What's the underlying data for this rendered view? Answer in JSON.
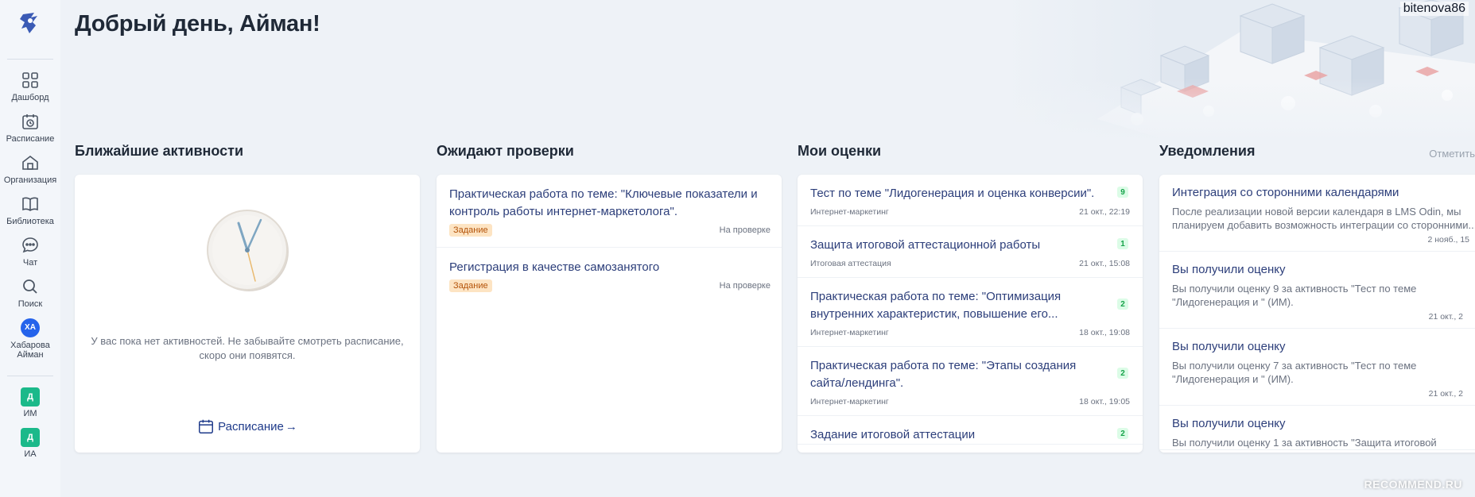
{
  "header": {
    "greeting": "Добрый день, Айман!",
    "username": "bitenova86"
  },
  "sidebar": {
    "items": [
      {
        "label": "Дашборд",
        "icon": "grid-icon"
      },
      {
        "label": "Расписание",
        "icon": "calendar-clock-icon"
      },
      {
        "label": "Организация",
        "icon": "home-icon"
      },
      {
        "label": "Библиотека",
        "icon": "book-icon"
      },
      {
        "label": "Чат",
        "icon": "chat-icon"
      },
      {
        "label": "Поиск",
        "icon": "search-icon"
      }
    ],
    "user": {
      "initials": "ХА",
      "name_line1": "Хабарова",
      "name_line2": "Айман"
    },
    "courses": [
      {
        "letter": "Д",
        "label": "ИМ"
      },
      {
        "letter": "Д",
        "label": "ИА"
      }
    ]
  },
  "activities": {
    "title": "Ближайшие активности",
    "empty_text": "У вас пока нет активностей. Не забывайте смотреть расписание, скоро они появятся.",
    "schedule_link": "Расписание"
  },
  "reviews": {
    "title": "Ожидают проверки",
    "items": [
      {
        "title": "Практическая работа по теме: \"Ключевые показатели и контроль работы интернет-маркетолога\".",
        "tag": "Задание",
        "status": "На проверке"
      },
      {
        "title": "Регистрация в качестве самозанятого",
        "tag": "Задание",
        "status": "На проверке"
      }
    ]
  },
  "grades": {
    "title": "Мои оценки",
    "items": [
      {
        "title": "Тест по теме \"Лидогенерация и оценка конверсии\".",
        "score": "9",
        "course": "Интернет-маркетинг",
        "date": "21 окт., 22:19"
      },
      {
        "title": "Защита итоговой аттестационной работы",
        "score": "1",
        "course": "Итоговая аттестация",
        "date": "21 окт., 15:08"
      },
      {
        "title": "Практическая работа по теме: \"Оптимизация внутренних характеристик, повышение его...",
        "score": "2",
        "course": "Интернет-маркетинг",
        "date": "18 окт., 19:08"
      },
      {
        "title": "Практическая работа по теме: \"Этапы создания сайта/лендинга\".",
        "score": "2",
        "course": "Интернет-маркетинг",
        "date": "18 окт., 19:05"
      },
      {
        "title": "Задание итоговой аттестации",
        "score": "2",
        "course": "",
        "date": ""
      }
    ]
  },
  "notifications": {
    "title": "Уведомления",
    "mark_read": "Отметить",
    "items": [
      {
        "title": "Интеграция со сторонними календарями",
        "body_line1": "После реализации новой версии календаря в LMS Odin, мы",
        "body_line2": "планируем добавить возможность интеграции со сторонними...",
        "date": "2 нояб., 15"
      },
      {
        "title": "Вы получили оценку",
        "body_line1": "Вы получили оценку 9 за активность \"Тест по теме",
        "body_line2": "\"Лидогенерация и \" (ИМ).",
        "date": "21 окт., 2"
      },
      {
        "title": "Вы получили оценку",
        "body_line1": "Вы получили оценку 7 за активность \"Тест по теме",
        "body_line2": "\"Лидогенерация и \" (ИМ).",
        "date": "21 окт., 2"
      },
      {
        "title": "Вы получили оценку",
        "body_line1": "Вы получили оценку 1 за активность \"Защита итоговой",
        "body_line2": "",
        "date": ""
      }
    ]
  },
  "watermark": "RECOMMEND.RU",
  "colors": {
    "accent": "#2c3e7a",
    "badge_green": "#1bb98a",
    "avatar_blue": "#2563eb",
    "tag_bg": "#fde4c3"
  }
}
